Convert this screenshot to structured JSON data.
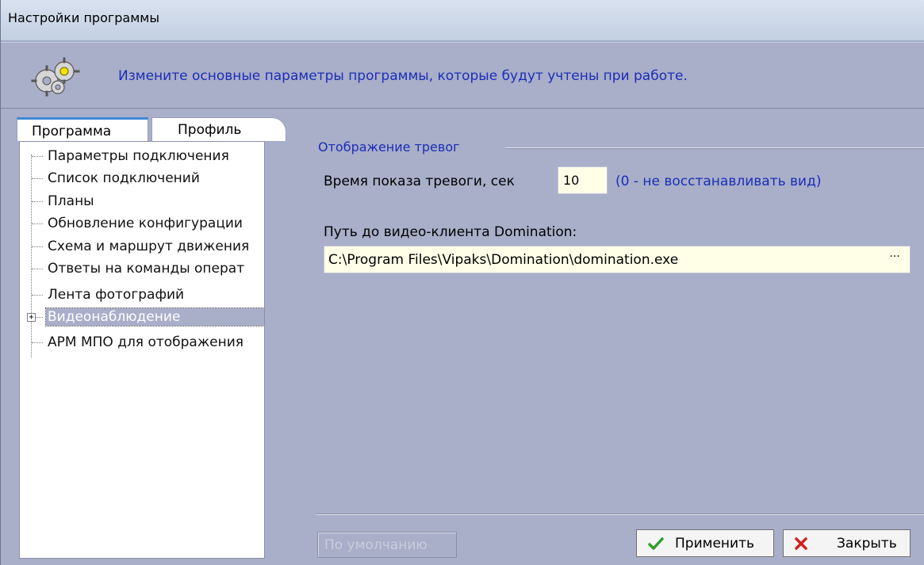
{
  "window": {
    "title": "Настройки программы"
  },
  "header": {
    "icon": "gears-icon",
    "text": "Измените основные параметры программы, которые будут учтены при работе."
  },
  "tabs": [
    {
      "label": "Программа",
      "active": true
    },
    {
      "label": "Профиль",
      "active": false
    }
  ],
  "tree": {
    "items": [
      {
        "label": "Параметры подключения"
      },
      {
        "label": "Список подключений"
      },
      {
        "label": "Планы"
      },
      {
        "label": "Обновление конфигурации"
      },
      {
        "label": "Схема и маршрут движения"
      },
      {
        "label": "Ответы на команды операт"
      },
      {
        "label": "Лента фотографий"
      },
      {
        "label": "Видеонаблюдение",
        "selected": true,
        "expander": "+"
      },
      {
        "label": "АРМ МПО для отображения"
      }
    ]
  },
  "alarm_group": {
    "title": "Отображение тревог",
    "show_time_label": "Время показа тревоги, сек",
    "show_time_value": "10",
    "show_time_hint": "(0 - не восстанавливать вид)",
    "video_path_label": "Путь до видео-клиента Domination:",
    "video_path_value": "C:\\Program Files\\Vipaks\\Domination\\domination.exe",
    "browse_label": "···"
  },
  "buttons": {
    "default_label": "По умолчанию",
    "apply_label": "Применить",
    "close_label": "Закрыть"
  },
  "colors": {
    "background": "#a9aec9",
    "accent_text": "#1a2fb6",
    "input_bg": "#ffffe8",
    "apply_icon": "#2e9e2e",
    "close_icon": "#d42020"
  }
}
